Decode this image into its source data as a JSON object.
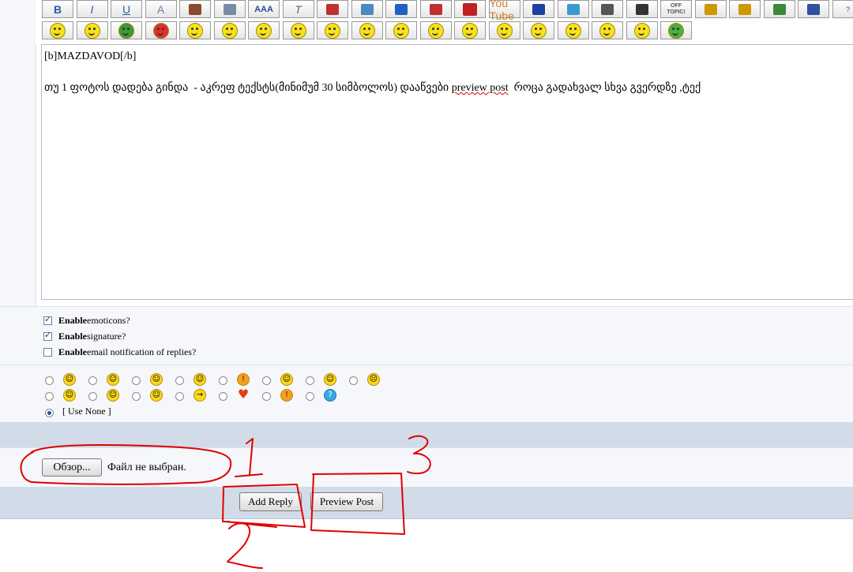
{
  "toolbar": {
    "row1": [
      "B",
      "I",
      "U",
      "A",
      "",
      "",
      "AAA",
      "T",
      "",
      "",
      "",
      "",
      "",
      "You Tube",
      "",
      "",
      "",
      "",
      "OFF TOPIC!",
      "",
      "",
      "",
      "",
      "?"
    ],
    "row2_count": 19
  },
  "editor": {
    "line1": "[b]MAZDAVOD[/b]",
    "line2_part1": "თუ 1 ფოტოს დადება გინდა  - აკრეფ ტექსტს(მინიმუმ 30 სიმბოლოს) დააწვები ",
    "line2_link": "preview post",
    "line2_part2": "  როცა გადახვალ სხვა გვერდზე ,ტექ"
  },
  "options": [
    {
      "bold": "Enable",
      "rest": " emoticons?",
      "checked": true
    },
    {
      "bold": "Enable",
      "rest": " signature?",
      "checked": true
    },
    {
      "bold": "Enable",
      "rest": " email notification of replies?",
      "checked": false
    }
  ],
  "icons": {
    "use_none": "[ Use None ]",
    "row1": [
      "☺",
      "☺",
      "☺",
      "☺",
      "!",
      "☺",
      "☺",
      "☹"
    ],
    "row2": [
      "☺",
      "☺",
      "☺",
      "→",
      "♥",
      "!",
      "?"
    ]
  },
  "upload": {
    "browse_label": "Обзор...",
    "status": "Файл не выбран."
  },
  "buttons": {
    "add_reply": "Add Reply",
    "preview_post": "Preview Post"
  },
  "annotations": [
    "1",
    "2",
    "3"
  ]
}
